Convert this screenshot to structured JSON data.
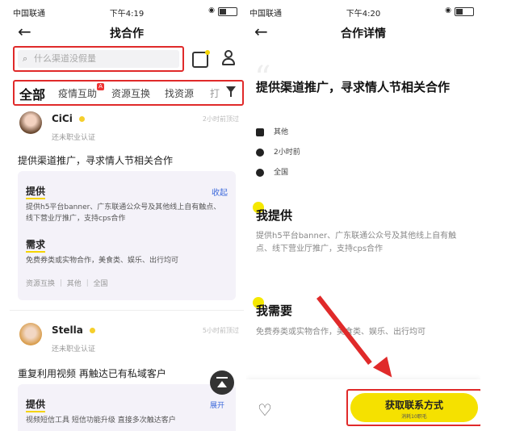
{
  "left_screen": {
    "status": {
      "carrier": "中国联通",
      "time": "下午4:19"
    },
    "nav_title": "找合作",
    "search_placeholder": "什么渠道没假量",
    "tabs": [
      "全部",
      "疫情互助",
      "资源互换",
      "找资源",
      "打"
    ],
    "cards": [
      {
        "username": "CiCi",
        "sub": "还未职业认证",
        "time": "2小时前顶过",
        "title": "提供渠道推广，寻求情人节相关合作",
        "provide_label": "提供",
        "collapse": "收起",
        "provide_text": "提供h5平台banner、广东联通公众号及其他线上自有触点、线下营业厅推广，支持cps合作",
        "need_label": "需求",
        "need_text": "免费券类或实物合作，美食类、娱乐、出行均可",
        "tags": "资源互换 ｜ 其他 ｜ 全国"
      },
      {
        "username": "Stella",
        "sub": "还未职业认证",
        "time": "5小时前顶过",
        "title": "重复利用视频 再触达已有私域客户",
        "provide_label": "提供",
        "provide_text": "视频短信工具 短信功能升级 直接多次触达客户"
      }
    ],
    "expand": "展开"
  },
  "right_screen": {
    "status": {
      "carrier": "中国联通",
      "time": "下午4:20"
    },
    "nav_title": "合作详情",
    "title": "提供渠道推广，寻求情人节相关合作",
    "meta": [
      "其他",
      "2小时前",
      "全国"
    ],
    "provide_title": "我提供",
    "provide_text": "提供h5平台banner、广东联通公众号及其他线上自有触点、线下营业厅推广，支持cps合作",
    "need_title": "我需要",
    "need_text": "免费券类或实物合作，美食类、娱乐、出行均可",
    "cta_label": "获取联系方式",
    "cta_sub": "消耗10职毛"
  },
  "colors": {
    "accent_yellow": "#f5e100",
    "highlight_red": "#e02a2a",
    "link_blue": "#3d6adb"
  }
}
